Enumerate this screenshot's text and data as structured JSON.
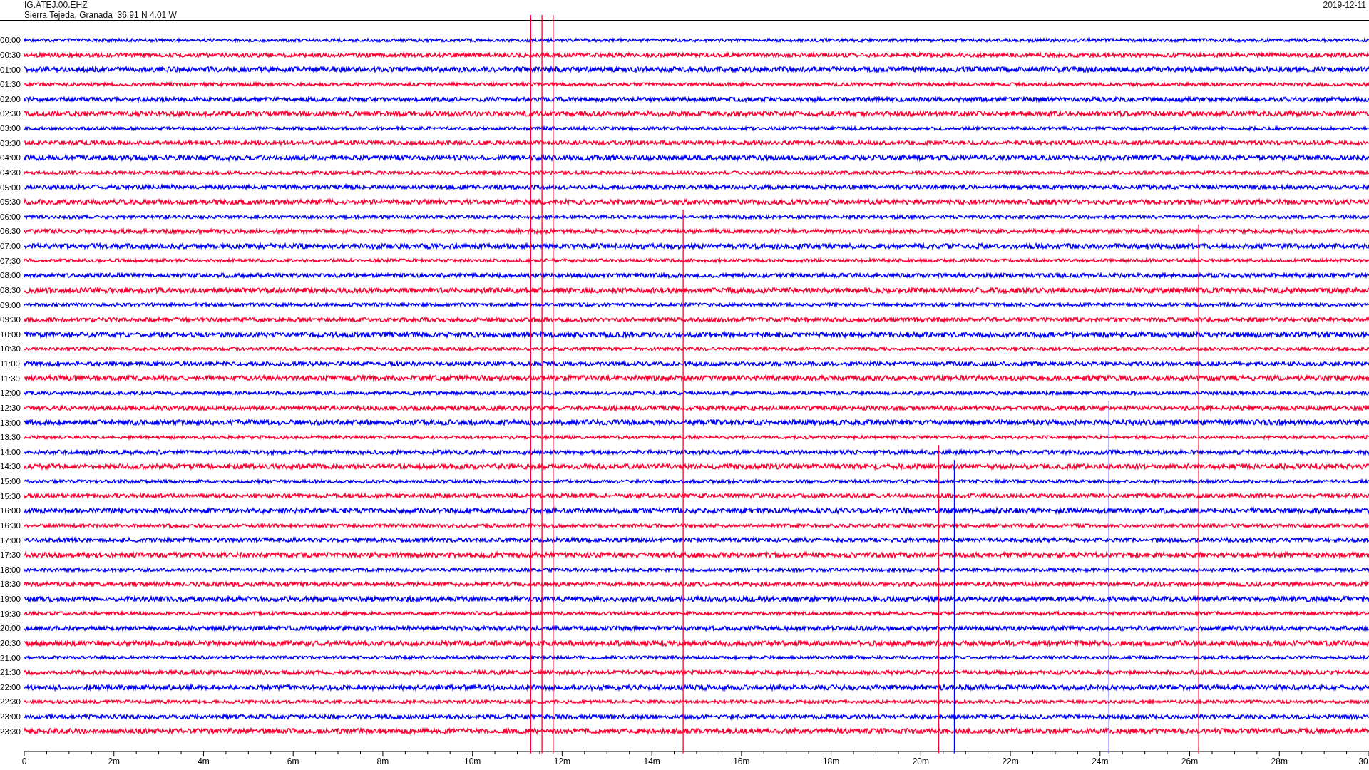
{
  "header": {
    "station": "IG.ATEJ.00.EHZ",
    "location": "Sierra Tejeda, Granada  36.91 N 4.01 W",
    "date": "2019-12-11"
  },
  "rows": [
    {
      "label": "00:00",
      "color": "#0000ff"
    },
    {
      "label": "00:30",
      "color": "#ff0033"
    },
    {
      "label": "01:00",
      "color": "#0000ff"
    },
    {
      "label": "01:30",
      "color": "#ff0033"
    },
    {
      "label": "02:00",
      "color": "#0000ff"
    },
    {
      "label": "02:30",
      "color": "#ff0033"
    },
    {
      "label": "03:00",
      "color": "#0000ff"
    },
    {
      "label": "03:30",
      "color": "#ff0033"
    },
    {
      "label": "04:00",
      "color": "#0000ff"
    },
    {
      "label": "04:30",
      "color": "#ff0033"
    },
    {
      "label": "05:00",
      "color": "#0000ff"
    },
    {
      "label": "05:30",
      "color": "#ff0033"
    },
    {
      "label": "06:00",
      "color": "#0000ff"
    },
    {
      "label": "06:30",
      "color": "#ff0033"
    },
    {
      "label": "07:00",
      "color": "#0000ff"
    },
    {
      "label": "07:30",
      "color": "#ff0033"
    },
    {
      "label": "08:00",
      "color": "#0000ff"
    },
    {
      "label": "08:30",
      "color": "#ff0033"
    },
    {
      "label": "09:00",
      "color": "#0000ff"
    },
    {
      "label": "09:30",
      "color": "#ff0033"
    },
    {
      "label": "10:00",
      "color": "#0000ff"
    },
    {
      "label": "10:30",
      "color": "#ff0033"
    },
    {
      "label": "11:00",
      "color": "#0000ff"
    },
    {
      "label": "11:30",
      "color": "#ff0033"
    },
    {
      "label": "12:00",
      "color": "#0000ff"
    },
    {
      "label": "12:30",
      "color": "#ff0033"
    },
    {
      "label": "13:00",
      "color": "#0000ff"
    },
    {
      "label": "13:30",
      "color": "#ff0033"
    },
    {
      "label": "14:00",
      "color": "#0000ff"
    },
    {
      "label": "14:30",
      "color": "#ff0033"
    },
    {
      "label": "15:00",
      "color": "#0000ff"
    },
    {
      "label": "15:30",
      "color": "#ff0033"
    },
    {
      "label": "16:00",
      "color": "#0000ff"
    },
    {
      "label": "16:30",
      "color": "#ff0033"
    },
    {
      "label": "17:00",
      "color": "#0000ff"
    },
    {
      "label": "17:30",
      "color": "#ff0033"
    },
    {
      "label": "18:00",
      "color": "#0000ff"
    },
    {
      "label": "18:30",
      "color": "#ff0033"
    },
    {
      "label": "19:00",
      "color": "#0000ff"
    },
    {
      "label": "19:30",
      "color": "#ff0033"
    },
    {
      "label": "20:00",
      "color": "#0000ff"
    },
    {
      "label": "20:30",
      "color": "#ff0033"
    },
    {
      "label": "21:00",
      "color": "#0000ff"
    },
    {
      "label": "21:30",
      "color": "#ff0033"
    },
    {
      "label": "22:00",
      "color": "#0000ff"
    },
    {
      "label": "22:30",
      "color": "#ff0033"
    },
    {
      "label": "23:00",
      "color": "#0000ff"
    },
    {
      "label": "23:30",
      "color": "#ff0033"
    }
  ],
  "x_axis": {
    "labels": [
      "0",
      "2m",
      "4m",
      "6m",
      "8m",
      "10m",
      "12m",
      "14m",
      "16m",
      "18m",
      "20m",
      "22m",
      "24m",
      "26m",
      "28m",
      "30"
    ]
  }
}
